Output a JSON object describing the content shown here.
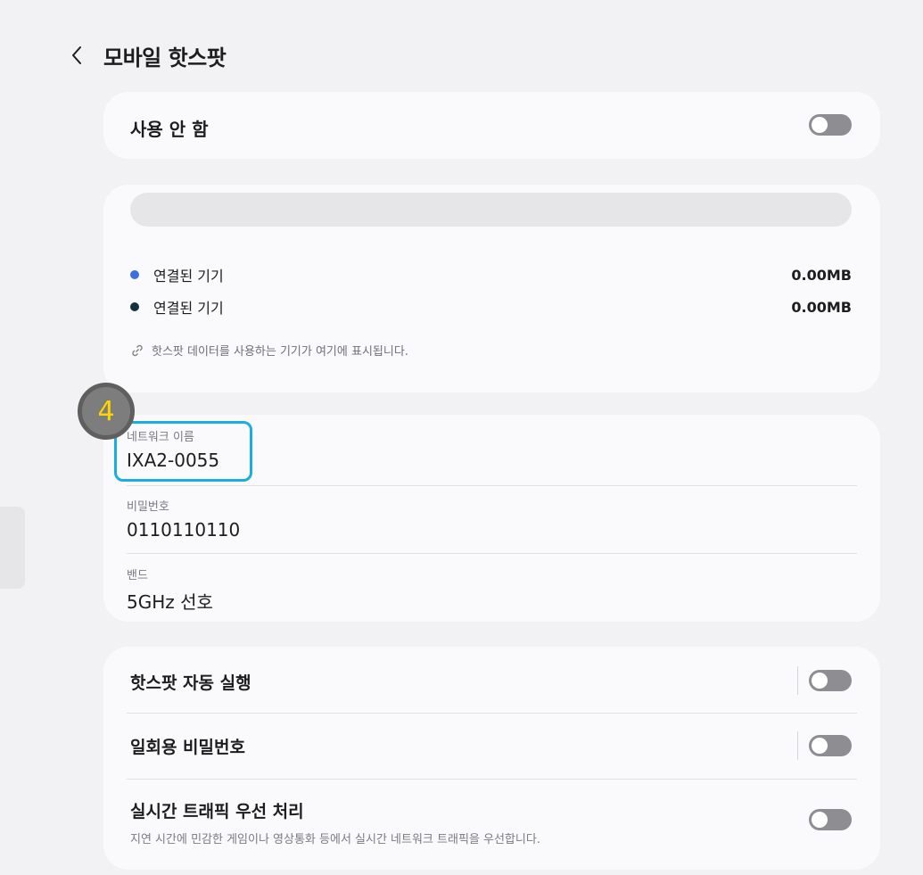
{
  "header": {
    "title": "모바일 핫스팟"
  },
  "enable": {
    "label": "사용 안 함",
    "on": false
  },
  "usage": {
    "devices": [
      {
        "label": "연결된 기기",
        "value": "0.00MB",
        "color": "#3a6fdc"
      },
      {
        "label": "연결된 기기",
        "value": "0.00MB",
        "color": "#17313a"
      }
    ],
    "hint": "핫스팟 데이터를 사용하는 기기가 여기에 표시됩니다."
  },
  "network": {
    "name_label": "네트워크 이름",
    "name_value": "IXA2-0055",
    "password_label": "비밀번호",
    "password_value": "0110110110",
    "band_label": "밴드",
    "band_value": "5GHz 선호"
  },
  "options": {
    "auto_label": "핫스팟 자동 실행",
    "otp_label": "일회용 비밀번호",
    "realtime_label": "실시간 트래픽 우선 처리",
    "realtime_desc": "지연 시간에 민감한 게임이나 영상통화 등에서 실시간 네트워크 트래픽을 우선합니다."
  },
  "annotation": {
    "step": "4",
    "color": "#1aaee0"
  }
}
